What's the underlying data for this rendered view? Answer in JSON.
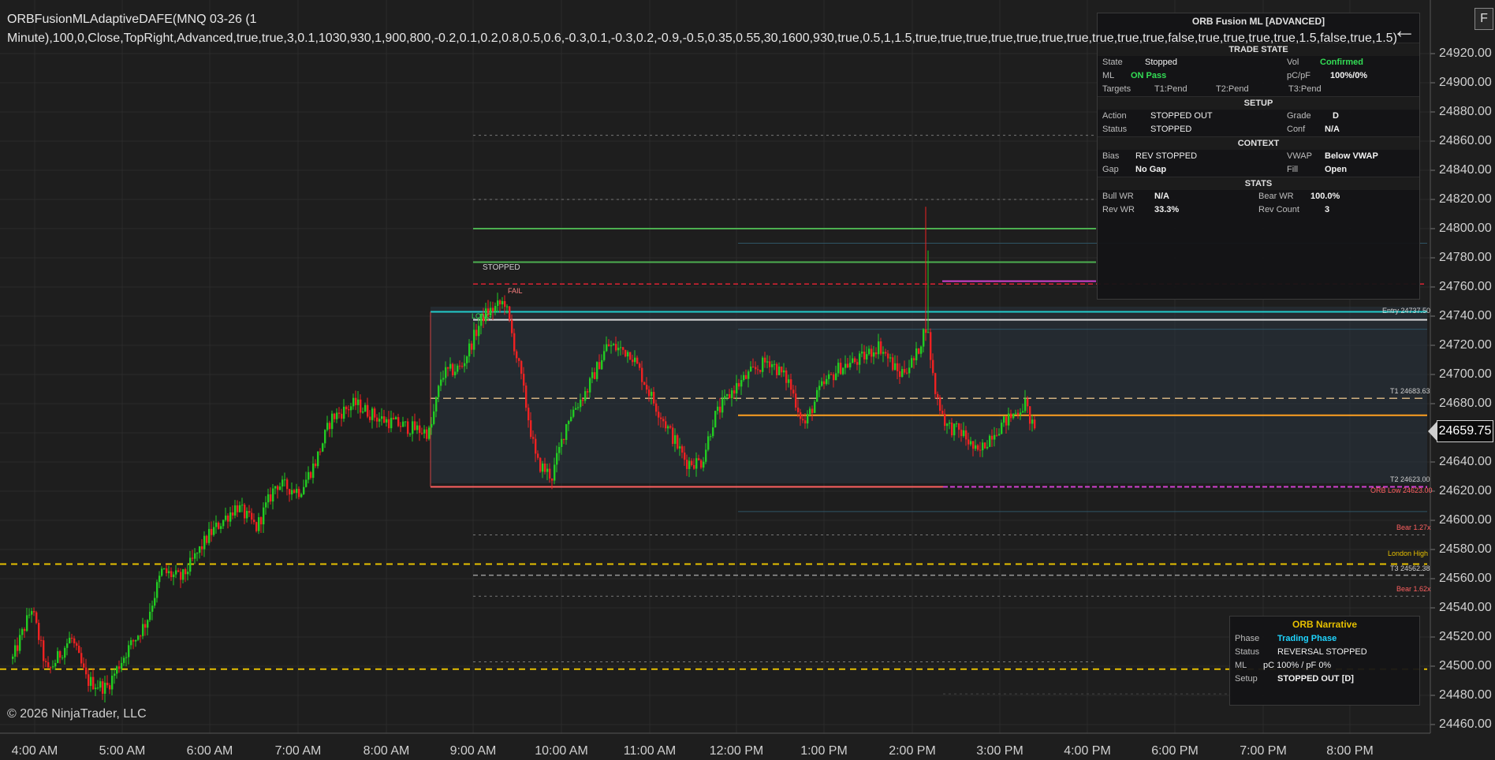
{
  "window": {
    "indicator_line1": "ORBFusionMLAdaptiveDAFE(MNQ 03-26 (1",
    "indicator_line2": "Minute),100,0,Close,TopRight,Advanced,true,true,3,0.1,1030,930,1,900,800,-0.2,0.1,0.2,0.8,0.5,0.6,-0.3,0.1,-0.3,0.2,-0.9,-0.5,0.35,0.55,30,1600,930,true,0.5,1,1.5,true,true,true,true,true,true,true,true,true,true,false,true,true,true,true,1.5,false,true,1.5)",
    "copyright": "© 2026 NinjaTrader, LLC",
    "corner_button": "F",
    "back_icon": "arrow-left-icon"
  },
  "price_axis": {
    "ticks": [
      "24920.00",
      "24900.00",
      "24880.00",
      "24860.00",
      "24840.00",
      "24820.00",
      "24800.00",
      "24780.00",
      "24760.00",
      "24740.00",
      "24720.00",
      "24700.00",
      "24680.00",
      "24660.00",
      "24640.00",
      "24620.00",
      "24600.00",
      "24580.00",
      "24560.00",
      "24540.00",
      "24520.00",
      "24500.00",
      "24480.00",
      "24460.00"
    ],
    "current_price": "24659.75"
  },
  "time_axis": {
    "ticks": [
      "4:00 AM",
      "5:00 AM",
      "6:00 AM",
      "7:00 AM",
      "8:00 AM",
      "9:00 AM",
      "10:00 AM",
      "11:00 AM",
      "12:00 PM",
      "1:00 PM",
      "2:00 PM",
      "3:00 PM",
      "4:00 PM",
      "6:00 PM",
      "7:00 PM",
      "8:00 PM"
    ]
  },
  "chart_labels": {
    "stopped": "STOPPED",
    "long": "LONG",
    "fail": "FAIL",
    "entry": "Entry 24737.50",
    "t1": "T1 24683.63",
    "t2": "T2 24623.00",
    "orb_low": "ORB Low 24623.00",
    "bear_127": "Bear 1.27x",
    "london_high": "London High",
    "t3": "T3 24562.38",
    "bear_162": "Bear 1.62x"
  },
  "main_panel": {
    "title": "ORB Fusion ML [ADVANCED]",
    "trade_state_header": "TRADE STATE",
    "state_label": "State",
    "state_value": "Stopped",
    "vol_label": "Vol",
    "vol_value": "Confirmed",
    "ml_label": "ML",
    "ml_value": "ON Pass",
    "pcpf_label": "pC/pF",
    "pcpf_value": "100%/0%",
    "targets_label": "Targets",
    "t1_value": "T1:Pend",
    "t2_value": "T2:Pend",
    "t3_value": "T3:Pend",
    "setup_header": "SETUP",
    "action_label": "Action",
    "action_value": "STOPPED OUT",
    "grade_label": "Grade",
    "grade_value": "D",
    "status_label": "Status",
    "status_value": "STOPPED",
    "conf_label": "Conf",
    "conf_value": "N/A",
    "context_header": "CONTEXT",
    "bias_label": "Bias",
    "bias_value": "REV STOPPED",
    "vwap_label": "VWAP",
    "vwap_value": "Below VWAP",
    "gap_label": "Gap",
    "gap_value": "No Gap",
    "fill_label": "Fill",
    "fill_value": "Open",
    "stats_header": "STATS",
    "bullwr_label": "Bull WR",
    "bullwr_value": "N/A",
    "bearwr_label": "Bear WR",
    "bearwr_value": "100.0%",
    "revwr_label": "Rev WR",
    "revwr_value": "33.3%",
    "revcount_label": "Rev Count",
    "revcount_value": "3"
  },
  "narrative_panel": {
    "title": "ORB Narrative",
    "phase_label": "Phase",
    "phase_value": "Trading Phase",
    "status_label": "Status",
    "status_value": "REVERSAL STOPPED",
    "ml_label": "ML",
    "ml_value": "pC 100% / pF 0%",
    "setup_label": "Setup",
    "setup_value": "STOPPED OUT [D]"
  },
  "colors": {
    "background": "#1e1e1e",
    "up_candle": "#22cc22",
    "down_candle": "#ee2222",
    "orb_box": "#2a3440",
    "entry_line": "#d8d8d8",
    "orb_high": "#22cccc",
    "orb_low": "#ff6060",
    "target_green": "#4caf50",
    "vwap": "#ffa020",
    "london": "#e6c000",
    "magenta": "#d040d0"
  }
}
